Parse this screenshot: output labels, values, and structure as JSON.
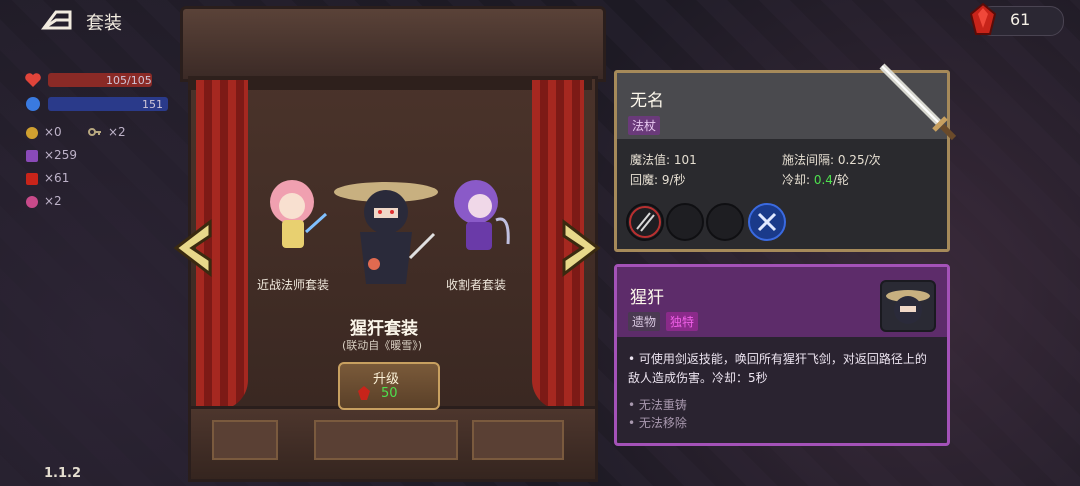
{
  "header": {
    "title": "套装",
    "back_icon": "back-arrow-icon"
  },
  "currency": {
    "gems": "61",
    "icon": "red-gem-icon"
  },
  "hud": {
    "hp": "105/105",
    "mp": "151",
    "resources": [
      {
        "icon": "coin-icon",
        "value": "×0"
      },
      {
        "icon": "key-icon",
        "value": "×2"
      },
      {
        "icon": "purple-crystal-icon",
        "value": "×259"
      },
      {
        "icon": "red-gem-icon",
        "value": "×61"
      },
      {
        "icon": "flower-icon",
        "value": "×2"
      }
    ]
  },
  "version": "1.1.2",
  "stage": {
    "characters": [
      {
        "label": "近战法师套装"
      },
      {
        "label": "猩犴套装"
      },
      {
        "label": "收割者套装"
      }
    ],
    "set_name": "猩犴套装",
    "set_subtitle": "(联动自《暖雪》)",
    "upgrade": {
      "label": "升级",
      "cost": "50"
    }
  },
  "weapon": {
    "name": "无名",
    "type_tag": "法杖",
    "stats": [
      {
        "label": "魔法值: 101"
      },
      {
        "label": "施法间隔: 0.25/次"
      },
      {
        "label": "回魔: 9/秒"
      },
      {
        "label_pre": "冷却: ",
        "highlight": "0.4",
        "label_post": "/轮"
      }
    ],
    "slots": [
      "slot-1",
      "slot-2",
      "slot-3",
      "slot-4"
    ]
  },
  "relic": {
    "name": "猩犴",
    "tags": [
      "遗物",
      "独特"
    ],
    "description": "• 可使用剑返技能，唤回所有猩犴飞剑，对返回路径上的敌人造成伤害。冷却：5秒",
    "notes": [
      "• 无法重铸",
      "• 无法移除"
    ]
  },
  "colors": {
    "weapon_border": "#a68a5a",
    "relic_border": "#a452b8",
    "tag_unique": "#e05ad8",
    "highlight_green": "#4ee04e"
  }
}
